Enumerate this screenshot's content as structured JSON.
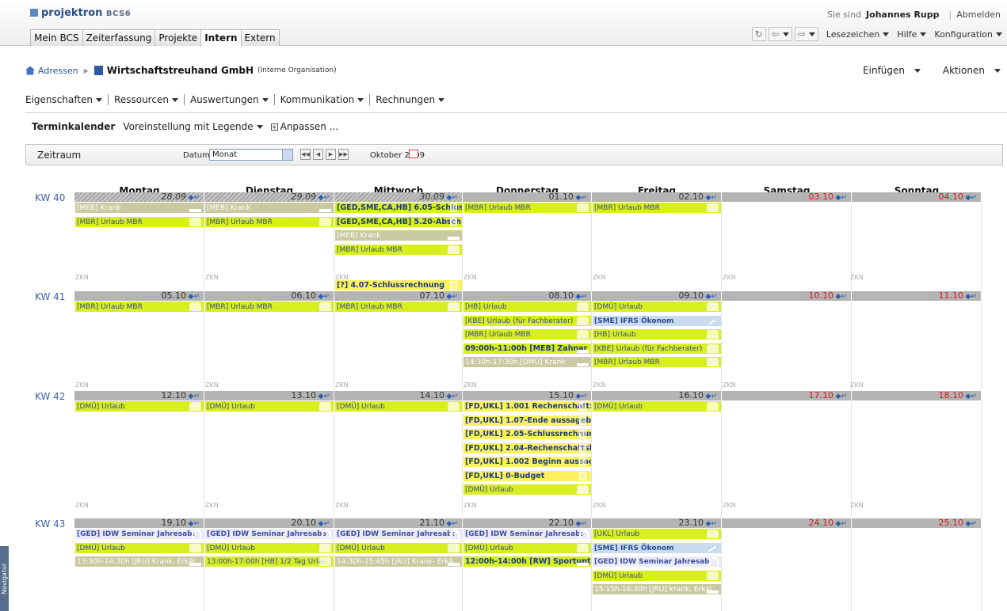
{
  "app": {
    "logo": "projektron",
    "version": "BCS6"
  },
  "user": {
    "prefix": "Sie sind",
    "name": "Johannes Rupp",
    "logout": "Abmelden"
  },
  "main_tabs": [
    "Mein BCS",
    "Zeiterfassung",
    "Projekte",
    "Intern",
    "Extern"
  ],
  "tools": {
    "bookmarks": "Lesezeichen",
    "help": "Hilfe",
    "config": "Konfiguration"
  },
  "breadcrumb": {
    "root": "Adressen",
    "org": "Wirtschaftstreuhand GmbH",
    "org_sub": "(Interne Organisation)"
  },
  "actions": {
    "insert": "Einfügen",
    "actions": "Aktionen"
  },
  "submenu": [
    "Eigenschaften",
    "Ressourcen",
    "Auswertungen",
    "Kommunikation",
    "Rechnungen"
  ],
  "view": {
    "current": "Terminkalender",
    "preset": "Voreinstellung mit Legende",
    "customize": "Anpassen ..."
  },
  "period": {
    "label": "Zeitraum",
    "date_label": "Datum:",
    "mode": "Monat",
    "month": "Oktober 2009"
  },
  "days": [
    "Montag",
    "Dienstag",
    "Mittwoch",
    "Donnerstag",
    "Freitag",
    "Samstag",
    "Sonntag"
  ],
  "weeks": [
    {
      "kw": "KW 40",
      "dates": [
        "28.09",
        "29.09",
        "30.09",
        "01.10",
        "02.10",
        "03.10",
        "04.10"
      ],
      "entries": [
        [
          {
            "t": "[MEB] Krank",
            "s": "gray",
            "i": "bed"
          },
          {
            "t": "[MBR] Urlaub MBR",
            "s": "",
            "i": "palm"
          }
        ],
        [
          {
            "t": "[MEB] Krank",
            "s": "gray",
            "i": "bed"
          },
          {
            "t": "[MBR] Urlaub MBR",
            "s": "",
            "i": "palm"
          }
        ],
        [
          {
            "t": "[GED,SME,CA,HB] 6.05-Schlus",
            "s": "bold",
            "i": "doc"
          },
          {
            "t": "[GED,SME,CA,HB] 5.20-Absch",
            "s": "bold",
            "i": "doc"
          },
          {
            "t": "[MEB] Krank",
            "s": "gray",
            "i": "bed"
          },
          {
            "t": "[MBR] Urlaub MBR",
            "s": "",
            "i": "palm"
          }
        ],
        [
          {
            "t": "[MBR] Urlaub MBR",
            "s": "",
            "i": "palm"
          }
        ],
        [
          {
            "t": "[MBR] Urlaub MBR",
            "s": "",
            "i": "palm"
          }
        ],
        [],
        []
      ],
      "zkn_entries": [
        [],
        [],
        [
          {
            "t": "[?] 4.07-Schlussrechnung",
            "s": "bold yellow",
            "i": "doc"
          }
        ],
        [],
        [],
        [],
        []
      ]
    },
    {
      "kw": "KW 41",
      "dates": [
        "05.10",
        "06.10",
        "07.10",
        "08.10",
        "09.10",
        "10.10",
        "11.10"
      ],
      "entries": [
        [
          {
            "t": "[MBR] Urlaub MBR",
            "s": "",
            "i": "palm"
          }
        ],
        [
          {
            "t": "[MBR] Urlaub MBR",
            "s": "",
            "i": "palm"
          }
        ],
        [
          {
            "t": "[MBR] Urlaub MBR",
            "s": "",
            "i": "palm"
          }
        ],
        [
          {
            "t": "[HB] Urlaub",
            "s": "",
            "i": "palm"
          },
          {
            "t": "[KBE] Urlaub (für Fachberater)",
            "s": "",
            "i": "palm"
          },
          {
            "t": "[MBR] Urlaub MBR",
            "s": "",
            "i": "palm"
          },
          {
            "t": "09:00h-11:00h [MEB] Zahnar",
            "s": "bold",
            "i": "bed"
          },
          {
            "t": "14:30h-17:30h [DMÜ] Krank",
            "s": "gray",
            "i": "bed"
          }
        ],
        [
          {
            "t": "[DMÜ] Urlaub",
            "s": "",
            "i": "palm"
          },
          {
            "t": "[SME] IFRS Ökonom",
            "s": "blue",
            "i": "tool"
          },
          {
            "t": "[HB] Urlaub",
            "s": "",
            "i": "palm"
          },
          {
            "t": "[KBE] Urlaub (für Fachberater)",
            "s": "",
            "i": "palm"
          },
          {
            "t": "[MBR] Urlaub MBR",
            "s": "",
            "i": "palm"
          }
        ],
        [],
        []
      ],
      "zkn_entries": [
        [],
        [],
        [],
        [],
        [],
        [],
        []
      ]
    },
    {
      "kw": "KW 42",
      "dates": [
        "12.10",
        "13.10",
        "14.10",
        "15.10",
        "16.10",
        "17.10",
        "18.10"
      ],
      "entries": [
        [
          {
            "t": "[DMÜ] Urlaub",
            "s": "",
            "i": "palm"
          }
        ],
        [
          {
            "t": "[DMÜ] Urlaub",
            "s": "",
            "i": "palm"
          }
        ],
        [
          {
            "t": "[DMÜ] Urlaub",
            "s": "",
            "i": "palm"
          }
        ],
        [
          {
            "t": "[FD,UKL] 1.001 Rechenschaft:",
            "s": "bold yellow",
            "i": "doc"
          },
          {
            "t": "[FD,UKL] 1.07-Ende aussageb",
            "s": "bold yellow",
            "i": "doc"
          },
          {
            "t": "[FD,UKL] 2.05-Schlussrechnur",
            "s": "bold yellow",
            "i": "doc"
          },
          {
            "t": "[FD,UKL] 2.04-Rechenschaftsl",
            "s": "bold yellow",
            "i": "doc"
          },
          {
            "t": "[FD,UKL] 1.002 Beginn aussaç",
            "s": "bold yellow",
            "i": "doc"
          },
          {
            "t": "[FD,UKL] 0-Budget",
            "s": "bold yellow",
            "i": "doc"
          },
          {
            "t": "[DMÜ] Urlaub",
            "s": "",
            "i": "palm"
          }
        ],
        [
          {
            "t": "[DMÜ] Urlaub",
            "s": "",
            "i": "palm"
          }
        ],
        [],
        []
      ],
      "zkn_entries": [
        [],
        [],
        [],
        [],
        [],
        [],
        []
      ]
    },
    {
      "kw": "KW 43",
      "dates": [
        "19.10",
        "20.10",
        "21.10",
        "22.10",
        "23.10",
        "24.10",
        "25.10"
      ],
      "entries": [
        [
          {
            "t": "[GED] IDW Seminar Jahresab:",
            "s": "lilac",
            "i": "seat"
          },
          {
            "t": "[DMÜ] Urlaub",
            "s": "",
            "i": "palm"
          },
          {
            "t": "13:30h-14:30h [JRU] Krank, Erkäl",
            "s": "gray",
            "i": "bed"
          }
        ],
        [
          {
            "t": "[GED] IDW Seminar Jahresabs",
            "s": "lilac",
            "i": "seat"
          },
          {
            "t": "[DMÜ] Urlaub",
            "s": "",
            "i": "palm"
          },
          {
            "t": "13:00h-17:00h [HB] 1/2 Tag Urlau",
            "s": "",
            "i": "palm"
          }
        ],
        [
          {
            "t": "[GED] IDW Seminar Jahresab:",
            "s": "lilac",
            "i": "seat"
          },
          {
            "t": "[DMÜ] Urlaub",
            "s": "",
            "i": "palm"
          },
          {
            "t": "14:30h-15:45h [JRU] Krank- Erkä",
            "s": "gray",
            "i": "bed"
          }
        ],
        [
          {
            "t": "[GED] IDW Seminar Jahresab:",
            "s": "lilac",
            "i": "seat"
          },
          {
            "t": "[DMÜ] Urlaub",
            "s": "",
            "i": "palm"
          },
          {
            "t": "12:00h-14:00h [RW] Sportunt",
            "s": "bold",
            "i": "bed"
          }
        ],
        [
          {
            "t": "[UKL] Urlaub",
            "s": "",
            "i": "palm"
          },
          {
            "t": "[SME] IFRS Ökonom",
            "s": "blue",
            "i": "tool"
          },
          {
            "t": "[GED] IDW Seminar Jahresab",
            "s": "lilac",
            "i": "seat"
          },
          {
            "t": "[DMÜ] Urlaub",
            "s": "",
            "i": "palm"
          },
          {
            "t": "15:15h-16:30h [JRU] krank, Erkäl",
            "s": "gray",
            "i": "bed"
          }
        ],
        [],
        []
      ],
      "zkn_entries": [
        [],
        [],
        [],
        [],
        [],
        [],
        []
      ]
    }
  ],
  "zkn": "ZKN",
  "navigator": "Navigator"
}
